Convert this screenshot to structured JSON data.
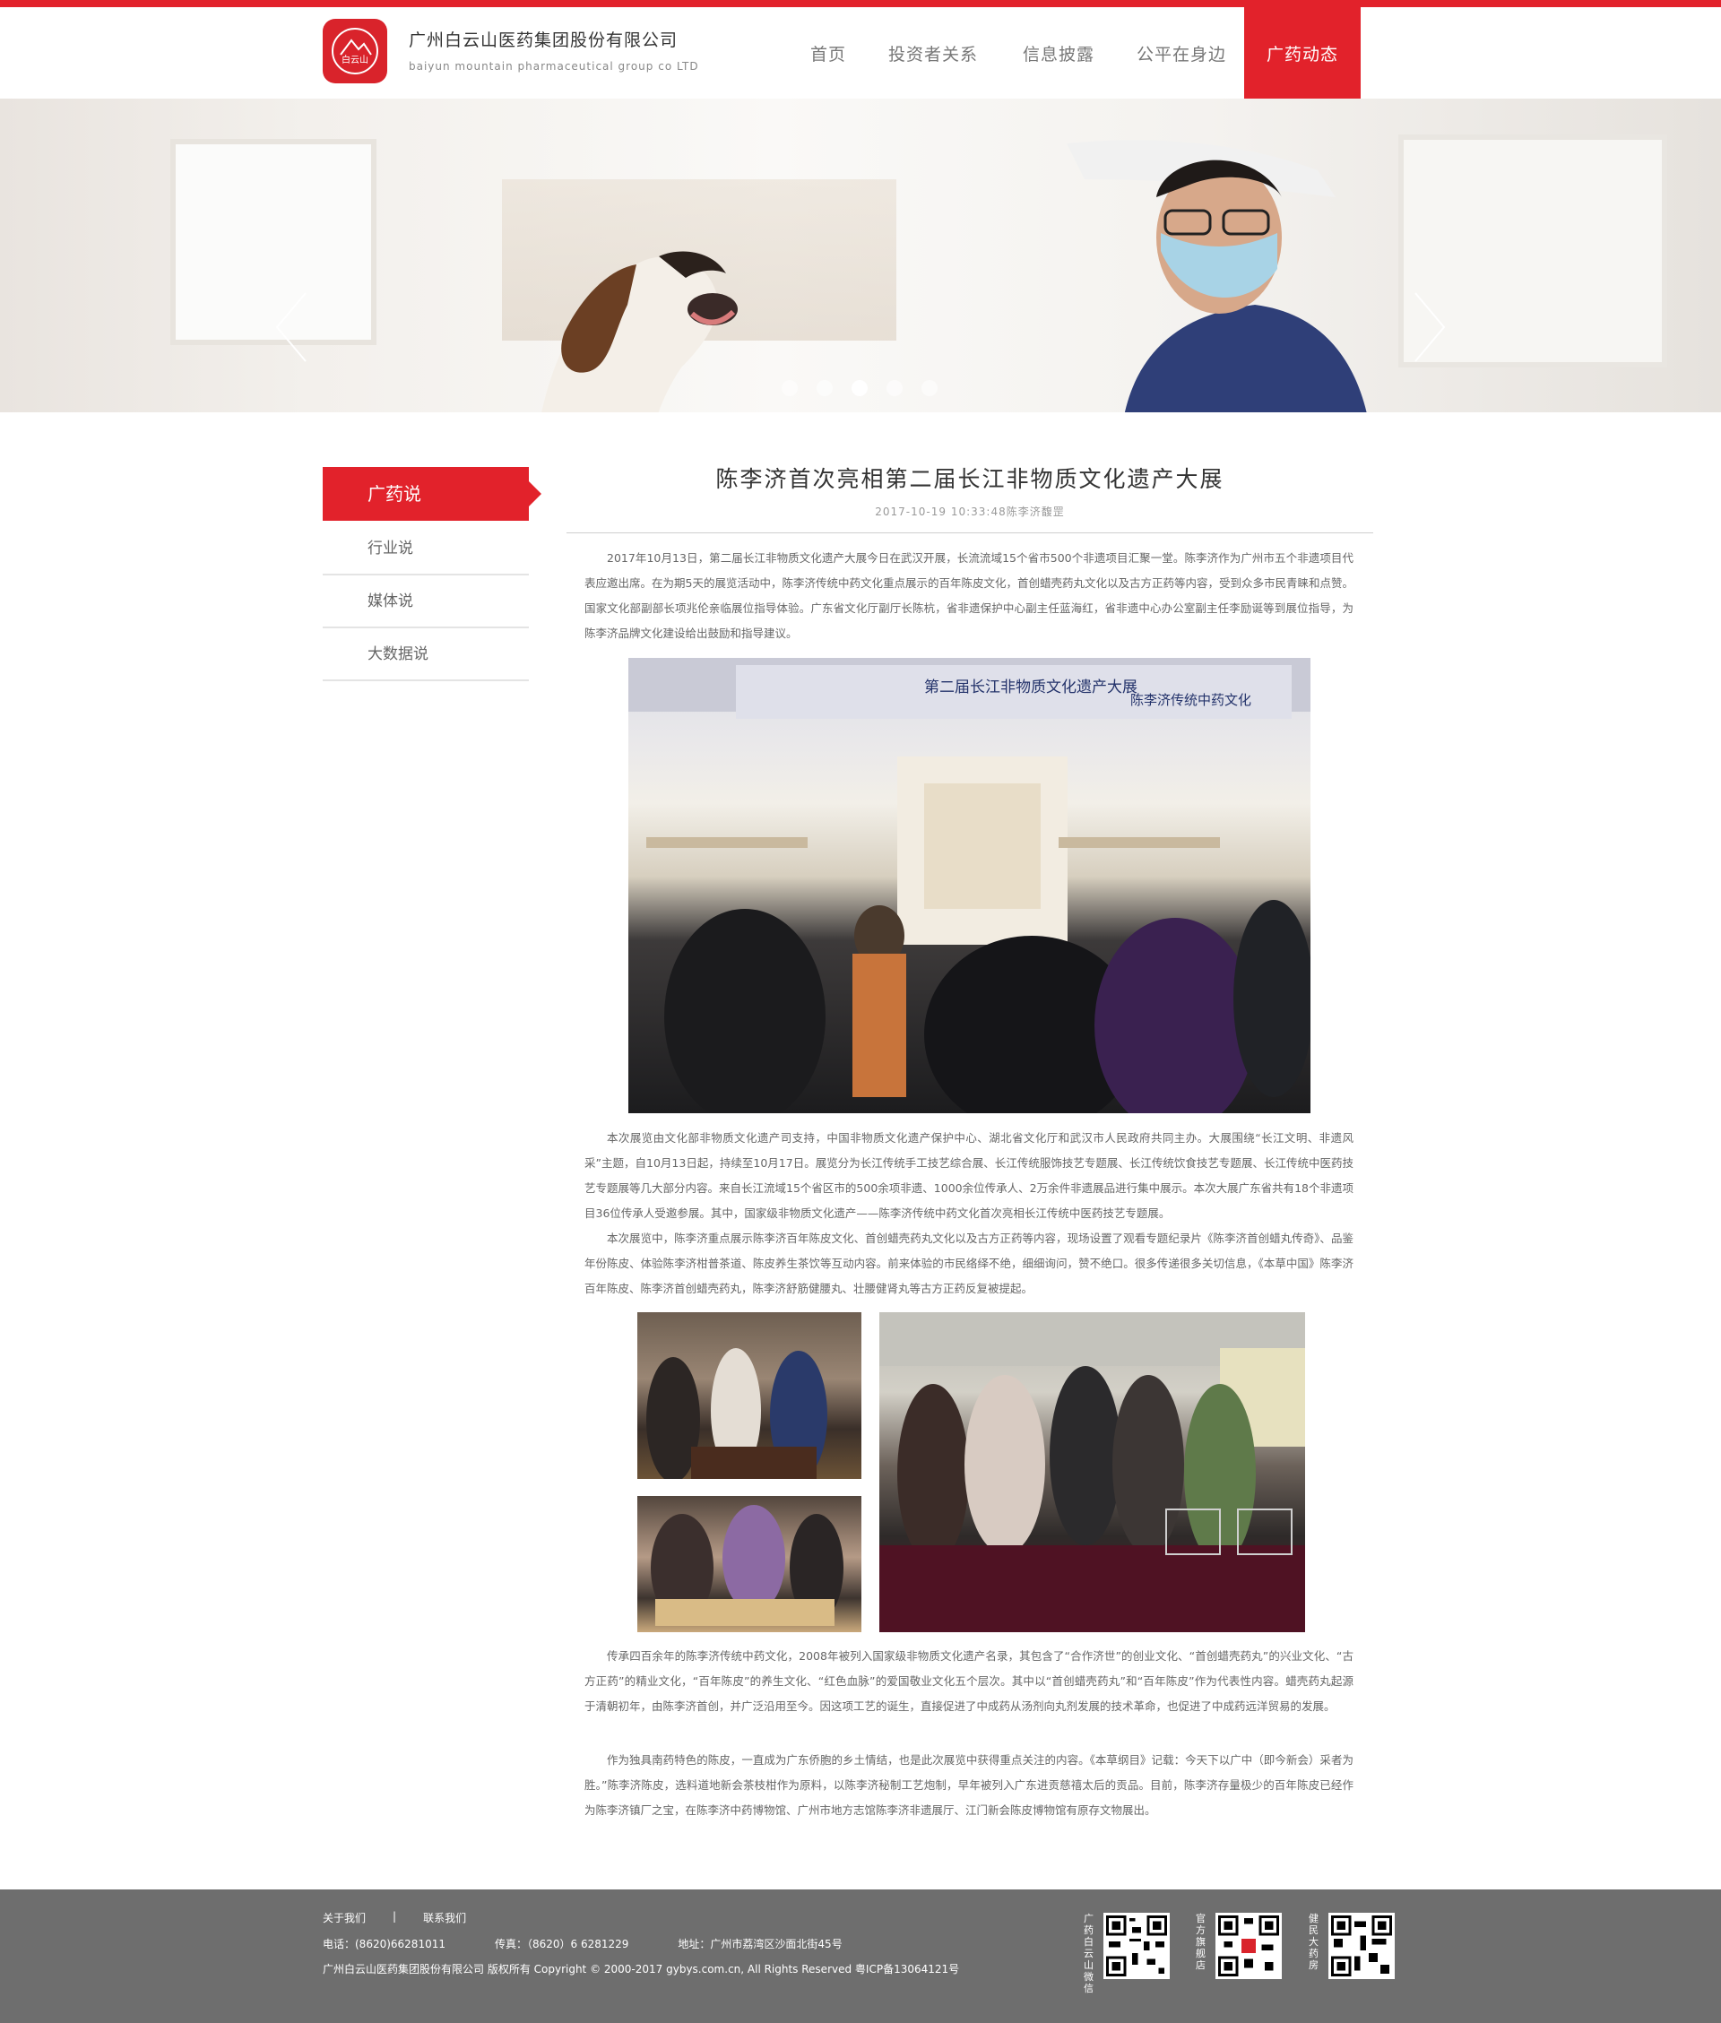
{
  "header": {
    "company_cn": "广州白云山医药集团股份有限公司",
    "company_en": "baiyun mountain pharmaceutical group co LTD",
    "logo_text": "白云山",
    "nav": [
      "首页",
      "投资者关系",
      "信息披露",
      "公平在身边",
      "广药动态"
    ],
    "nav_active_index": 4,
    "accent_color": "#e2222b"
  },
  "banner": {
    "slide_count": 5,
    "active_slide_index": 2
  },
  "sidebar": {
    "active_label": "广药说",
    "items": [
      "行业说",
      "媒体说",
      "大数据说"
    ]
  },
  "article": {
    "title": "陈李济首次亮相第二届长江非物质文化遗产大展",
    "meta": "2017-10-19  10:33:48陈李济馥罡",
    "paragraphs": [
      "2017年10月13日，第二届长江非物质文化遗产大展今日在武汉开展，长流流域15个省市500个非遗项目汇聚一堂。陈李济作为广州市五个非遗项目代表应邀出席。在为期5天的展览活动中，陈李济传统中药文化重点展示的百年陈皮文化，首创蜡壳药丸文化以及古方正药等内容，受到众多市民青睐和点赞。国家文化部副部长项兆伦亲临展位指导体验。广东省文化厅副厅长陈杭，省非遗保护中心副主任蓝海红，省非遗中心办公室副主任李励诞等到展位指导，为陈李济品牌文化建设给出鼓励和指导建议。",
      "本次展览由文化部非物质文化遗产司支持，中国非物质文化遗产保护中心、湖北省文化厅和武汉市人民政府共同主办。大展围绕“长江文明、非遗风采”主题，自10月13日起，持续至10月17日。展览分为长江传统手工技艺综合展、长江传统服饰技艺专题展、长江传统饮食技艺专题展、长江传统中医药技艺专题展等几大部分内容。来自长江流域15个省区市的500余项非遗、1000余位传承人、2万余件非遗展品进行集中展示。本次大展广东省共有18个非遗项目36位传承人受邀参展。其中，国家级非物质文化遗产——陈李济传统中药文化首次亮相长江传统中医药技艺专题展。",
      "本次展览中，陈李济重点展示陈李济百年陈皮文化、首创蜡壳药丸文化以及古方正药等内容，现场设置了观看专题纪录片《陈李济首创蜡丸传奇》、品鉴年份陈皮、体验陈李济柑普茶道、陈皮养生茶饮等互动内容。前来体验的市民络绎不绝，细细询问，赞不绝口。很多传递很多关切信息，《本草中国》陈李济百年陈皮、陈李济首创蜡壳药丸，陈李济舒筋健腰丸、壮腰健肾丸等古方正药反复被提起。",
      "传承四百余年的陈李济传统中药文化，2008年被列入国家级非物质文化遗产名录，其包含了“合作济世”的创业文化、“首创蜡壳药丸”的兴业文化、“古方正药”的精业文化，“百年陈皮”的养生文化、“红色血脉”的爱国敬业文化五个层次。其中以“首创蜡壳药丸”和“百年陈皮”作为代表性内容。蜡壳药丸起源于清朝初年，由陈李济首创，并广泛沿用至今。因这项工艺的诞生，直接促进了中成药从汤剂向丸剂发展的技术革命，也促进了中成药远洋贸易的发展。",
      "作为独具南药特色的陈皮，一直成为广东侨胞的乡土情结，也是此次展览中获得重点关注的内容。《本草纲目》记载：今天下以广中（即今新会）采者为胜。”陈李济陈皮，选料道地新会茶枝柑作为原料，以陈李济秘制工艺炮制，早年被列入广东进贡慈禧太后的贡品。目前，陈李济存量极少的百年陈皮已经作为陈李济镇厂之宝，在陈李济中药博物馆、广州市地方志馆陈李济非遗展厅、江门新会陈皮博物馆有原存文物展出。"
    ]
  },
  "footer": {
    "links": [
      "关于我们",
      "|",
      "联系我们"
    ],
    "phone": "电话：(8620)66281011",
    "fax": "传真：（8620）6 6281229",
    "address": "地址：广州市荔湾区沙面北街45号",
    "copyright": "广州白云山医药集团股份有限公司 版权所有 Copyright © 2000-2017 gybys.com.cn, All Rights Reserved 粤ICP备13064121号",
    "qr_codes": [
      "广药白云山微信",
      "官方旗舰店",
      "健民大药房"
    ]
  }
}
